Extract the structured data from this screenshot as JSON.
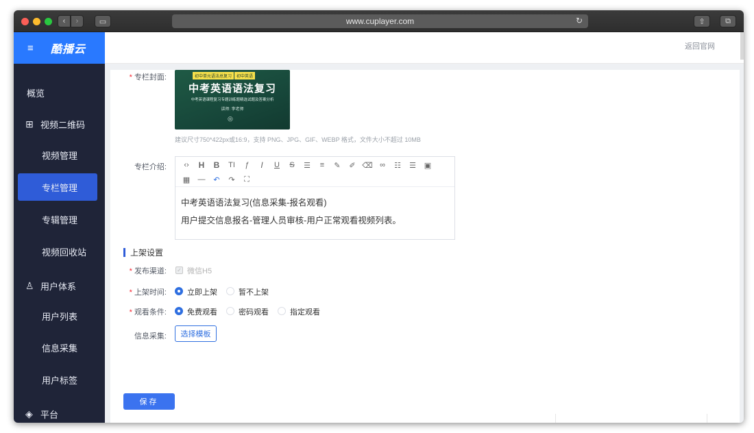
{
  "browser": {
    "url": "www.cuplayer.com"
  },
  "sidebar": {
    "brand": "酷播云",
    "items": [
      {
        "label": "概览"
      },
      {
        "label": "视频二维码"
      },
      {
        "label": "视频管理"
      },
      {
        "label": "专栏管理"
      },
      {
        "label": "专辑管理"
      },
      {
        "label": "视频回收站"
      },
      {
        "label": "用户体系"
      },
      {
        "label": "用户列表"
      },
      {
        "label": "信息采集"
      },
      {
        "label": "用户标签"
      },
      {
        "label": "平台"
      }
    ]
  },
  "header": {
    "back_link": "返回官网"
  },
  "form": {
    "cover_label": "专栏封面:",
    "cover_image": {
      "tag_left": "初中单元语法总复习",
      "tag_right": "初中英语",
      "title": "中考英语语法复习",
      "subtitle": "中考英语课程复习专题训练题精选试题及答案分析",
      "author": "讲师: 李老师"
    },
    "cover_hint": "建议尺寸750*422px或16:9，支持 PNG、JPG、GIF、WEBP 格式，文件大小不超过 10MB",
    "intro_label": "专栏介绍:",
    "intro_line1": "中考英语语法复习(信息采集-报名观看)",
    "intro_line2": "用户提交信息报名-管理人员审核-用户正常观看视频列表。",
    "section_title": "上架设置",
    "channel_label": "发布渠道:",
    "channel_option": "微信H5",
    "time_label": "上架时间:",
    "time_options": [
      "立即上架",
      "暂不上架"
    ],
    "time_selected": "立即上架",
    "watch_label": "观看条件:",
    "watch_options": [
      "免费观看",
      "密码观看",
      "指定观看"
    ],
    "watch_selected": "免费观看",
    "collect_label": "信息采集:",
    "collect_button": "选择模板",
    "save_button": "保存"
  },
  "colors": {
    "brand_blue": "#2979ff",
    "sidebar_bg": "#1f2438",
    "active_item": "#2f5cd8",
    "primary": "#3b73ef"
  }
}
